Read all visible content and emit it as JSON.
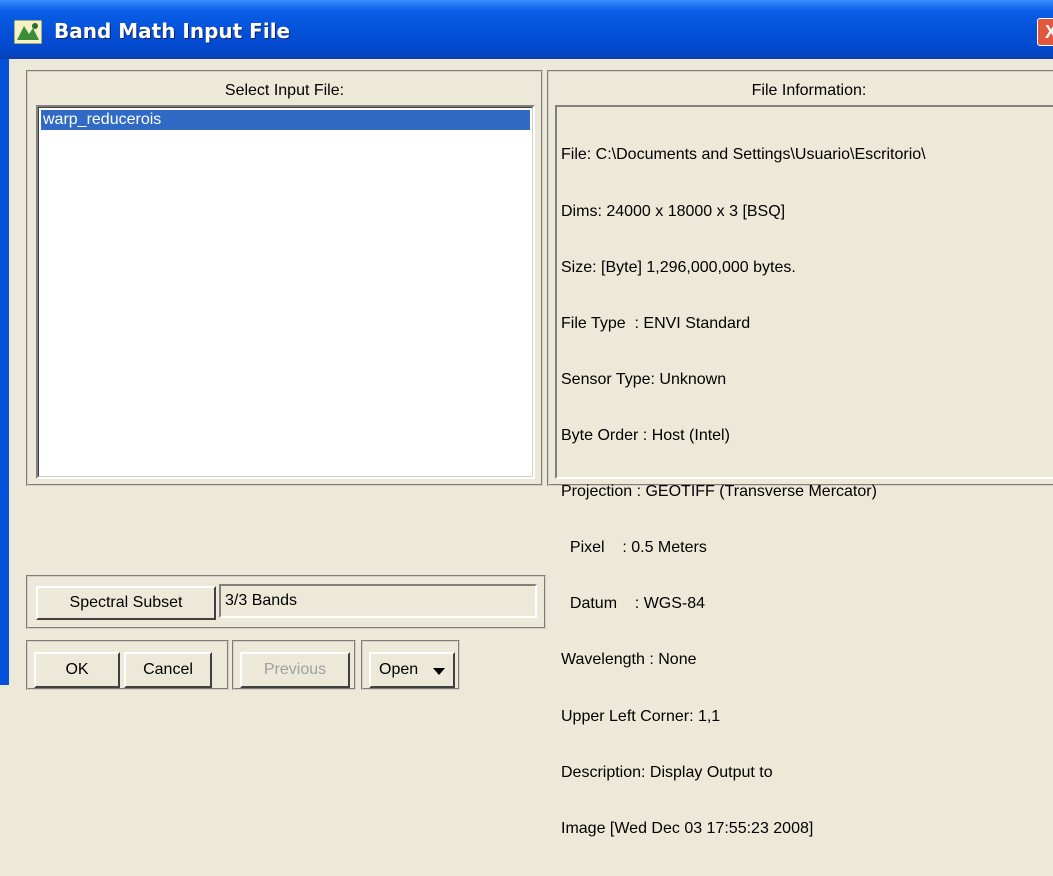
{
  "window": {
    "title": "Band Math Input File",
    "close_glyph": "X",
    "icon": "envi-app-icon"
  },
  "select_panel": {
    "label": "Select Input File:",
    "items": [
      "warp_reducerois"
    ],
    "selected_index": 0
  },
  "info_panel": {
    "label": "File Information:",
    "lines": [
      "File: C:\\Documents and Settings\\Usuario\\Escritorio\\",
      "Dims: 24000 x 18000 x 3 [BSQ]",
      "Size: [Byte] 1,296,000,000 bytes.",
      "File Type  : ENVI Standard",
      "Sensor Type: Unknown",
      "Byte Order : Host (Intel)",
      "Projection : GEOTIFF (Transverse Mercator)",
      "  Pixel    : 0.5 Meters",
      "  Datum    : WGS-84",
      "Wavelength : None",
      "Upper Left Corner: 1,1",
      "Description: Display Output to",
      "Image [Wed Dec 03 17:55:23 2008]"
    ]
  },
  "subset": {
    "button_label": "Spectral Subset",
    "value": "3/3 Bands"
  },
  "buttons": {
    "ok": "OK",
    "cancel": "Cancel",
    "previous": "Previous",
    "open": "Open"
  },
  "colors": {
    "titlebar": "#0450d8",
    "selection": "#316ac5",
    "dialog_bg": "#ece9d8"
  }
}
